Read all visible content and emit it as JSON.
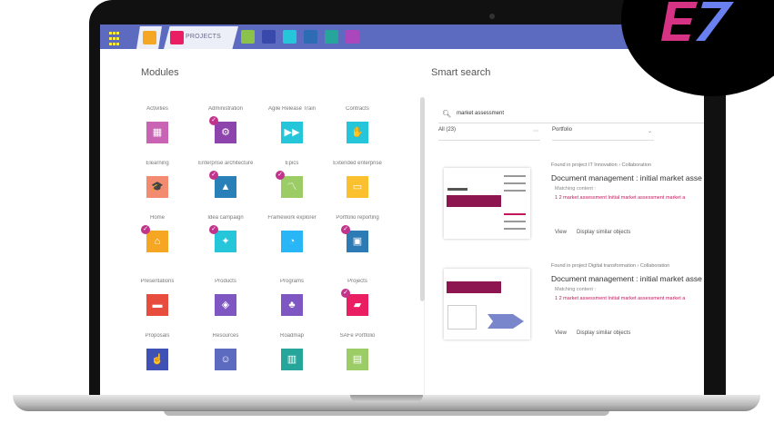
{
  "toolbar": {
    "tab_label": "PROJECTS",
    "colors": [
      "#f5a623",
      "#e91e63",
      "#8bc34a",
      "#5c6bc0",
      "#26c6da",
      "#4a5ac0",
      "#26a69a",
      "#ab47bc"
    ]
  },
  "modules_title": "Modules",
  "smart_search_title": "Smart search",
  "modules": [
    {
      "label": "Activities",
      "icon": "document-icon",
      "color": "#c964b4",
      "checked": false,
      "glyph": "▦"
    },
    {
      "label": "Administration",
      "icon": "gear-icon",
      "color": "#8e44ad",
      "checked": true,
      "glyph": "⚙"
    },
    {
      "label": "Agile Release Train",
      "icon": "train-icon",
      "color": "#26c6da",
      "checked": false,
      "glyph": "▶▶"
    },
    {
      "label": "Contracts",
      "icon": "handshake-icon",
      "color": "#26c6da",
      "checked": false,
      "glyph": "✋"
    },
    {
      "label": "Elearning",
      "icon": "graduation-icon",
      "color": "#f28b70",
      "checked": false,
      "glyph": "🎓"
    },
    {
      "label": "Enterprise architecture",
      "icon": "shapes-icon",
      "color": "#2980b9",
      "checked": true,
      "glyph": "▲"
    },
    {
      "label": "Epics",
      "icon": "chart-icon",
      "color": "#9ccc65",
      "checked": true,
      "glyph": "〽"
    },
    {
      "label": "Extended enterprise",
      "icon": "screen-icon",
      "color": "#fbc02d",
      "checked": false,
      "glyph": "▭"
    },
    {
      "label": "Home",
      "icon": "home-icon",
      "color": "#f5a623",
      "checked": true,
      "glyph": "⌂"
    },
    {
      "label": "Idea campaign",
      "icon": "bulb-icon",
      "color": "#26c6da",
      "checked": true,
      "glyph": "✦"
    },
    {
      "label": "Framework explorer",
      "icon": "pie-icon",
      "color": "#29b6f6",
      "checked": false,
      "glyph": "◔"
    },
    {
      "label": "Portfolio reporting",
      "icon": "briefcase-icon",
      "color": "#2d7bb5",
      "checked": true,
      "glyph": "▣"
    },
    {
      "label": "Presentations",
      "icon": "easel-icon",
      "color": "#e74c3c",
      "checked": false,
      "glyph": "▬"
    },
    {
      "label": "Products",
      "icon": "box-icon",
      "color": "#7e57c2",
      "checked": false,
      "glyph": "◈"
    },
    {
      "label": "Programs",
      "icon": "group-icon",
      "color": "#7e57c2",
      "checked": false,
      "glyph": "♣"
    },
    {
      "label": "Projects",
      "icon": "folder-icon",
      "color": "#e91e63",
      "checked": true,
      "glyph": "▰"
    },
    {
      "label": "Proposals",
      "icon": "hand-icon",
      "color": "#3f51b5",
      "checked": false,
      "glyph": "☝"
    },
    {
      "label": "Resources",
      "icon": "people-icon",
      "color": "#5c6bc0",
      "checked": false,
      "glyph": "☺"
    },
    {
      "label": "Roadmap",
      "icon": "map-icon",
      "color": "#26a69a",
      "checked": false,
      "glyph": "▥"
    },
    {
      "label": "SAFe Portfolio",
      "icon": "archive-icon",
      "color": "#9ccc65",
      "checked": false,
      "glyph": "▤"
    }
  ],
  "search": {
    "value": "market assessment",
    "filter_all": "All (23)",
    "filter_type": "Portfolio"
  },
  "results": [
    {
      "found": "Found in project IT Innovation › Collaboration",
      "title": "Document management : initial market asse",
      "match": "Matching content :",
      "snippet": "1 2 market assessment Initial market assessment market a",
      "view": "View",
      "similar": "Display similar objects"
    },
    {
      "found": "Found in project Digital transformation › Collaboration",
      "title": "Document management : initial market asse",
      "match": "Matching content :",
      "snippet": "1 2 market assessment Initial market assessment market a",
      "view": "View",
      "similar": "Display similar objects"
    }
  ]
}
